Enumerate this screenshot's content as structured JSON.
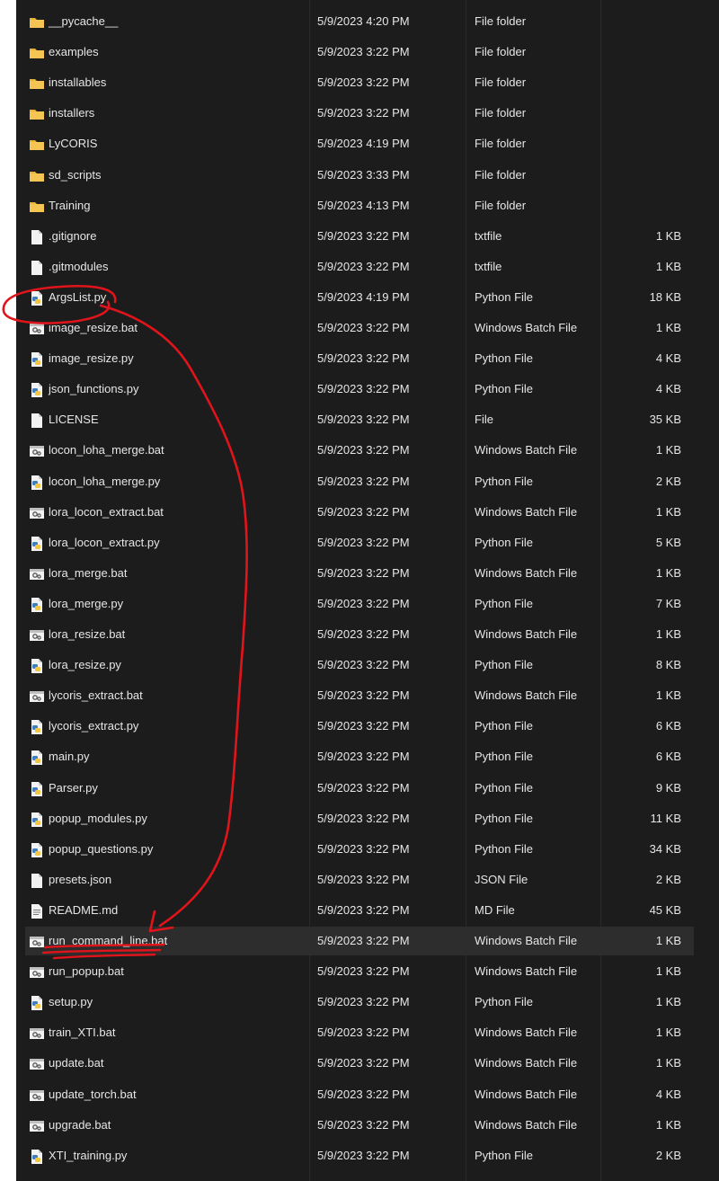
{
  "files": [
    {
      "name": "__pycache__",
      "date": "5/9/2023 4:20 PM",
      "type": "File folder",
      "size": "",
      "icon": "folder-icon"
    },
    {
      "name": "examples",
      "date": "5/9/2023 3:22 PM",
      "type": "File folder",
      "size": "",
      "icon": "folder-icon"
    },
    {
      "name": "installables",
      "date": "5/9/2023 3:22 PM",
      "type": "File folder",
      "size": "",
      "icon": "folder-icon"
    },
    {
      "name": "installers",
      "date": "5/9/2023 3:22 PM",
      "type": "File folder",
      "size": "",
      "icon": "folder-icon"
    },
    {
      "name": "LyCORIS",
      "date": "5/9/2023 4:19 PM",
      "type": "File folder",
      "size": "",
      "icon": "folder-icon"
    },
    {
      "name": "sd_scripts",
      "date": "5/9/2023 3:33 PM",
      "type": "File folder",
      "size": "",
      "icon": "folder-icon"
    },
    {
      "name": "Training",
      "date": "5/9/2023 4:13 PM",
      "type": "File folder",
      "size": "",
      "icon": "folder-icon"
    },
    {
      "name": ".gitignore",
      "date": "5/9/2023 3:22 PM",
      "type": "txtfile",
      "size": "1 KB",
      "icon": "blank-file-icon"
    },
    {
      "name": ".gitmodules",
      "date": "5/9/2023 3:22 PM",
      "type": "txtfile",
      "size": "1 KB",
      "icon": "blank-file-icon"
    },
    {
      "name": "ArgsList.py",
      "date": "5/9/2023 4:19 PM",
      "type": "Python File",
      "size": "18 KB",
      "icon": "python-file-icon"
    },
    {
      "name": "image_resize.bat",
      "date": "5/9/2023 3:22 PM",
      "type": "Windows Batch File",
      "size": "1 KB",
      "icon": "batch-file-icon"
    },
    {
      "name": "image_resize.py",
      "date": "5/9/2023 3:22 PM",
      "type": "Python File",
      "size": "4 KB",
      "icon": "python-file-icon"
    },
    {
      "name": "json_functions.py",
      "date": "5/9/2023 3:22 PM",
      "type": "Python File",
      "size": "4 KB",
      "icon": "python-file-icon"
    },
    {
      "name": "LICENSE",
      "date": "5/9/2023 3:22 PM",
      "type": "File",
      "size": "35 KB",
      "icon": "blank-file-icon"
    },
    {
      "name": "locon_loha_merge.bat",
      "date": "5/9/2023 3:22 PM",
      "type": "Windows Batch File",
      "size": "1 KB",
      "icon": "batch-file-icon"
    },
    {
      "name": "locon_loha_merge.py",
      "date": "5/9/2023 3:22 PM",
      "type": "Python File",
      "size": "2 KB",
      "icon": "python-file-icon"
    },
    {
      "name": "lora_locon_extract.bat",
      "date": "5/9/2023 3:22 PM",
      "type": "Windows Batch File",
      "size": "1 KB",
      "icon": "batch-file-icon"
    },
    {
      "name": "lora_locon_extract.py",
      "date": "5/9/2023 3:22 PM",
      "type": "Python File",
      "size": "5 KB",
      "icon": "python-file-icon"
    },
    {
      "name": "lora_merge.bat",
      "date": "5/9/2023 3:22 PM",
      "type": "Windows Batch File",
      "size": "1 KB",
      "icon": "batch-file-icon"
    },
    {
      "name": "lora_merge.py",
      "date": "5/9/2023 3:22 PM",
      "type": "Python File",
      "size": "7 KB",
      "icon": "python-file-icon"
    },
    {
      "name": "lora_resize.bat",
      "date": "5/9/2023 3:22 PM",
      "type": "Windows Batch File",
      "size": "1 KB",
      "icon": "batch-file-icon"
    },
    {
      "name": "lora_resize.py",
      "date": "5/9/2023 3:22 PM",
      "type": "Python File",
      "size": "8 KB",
      "icon": "python-file-icon"
    },
    {
      "name": "lycoris_extract.bat",
      "date": "5/9/2023 3:22 PM",
      "type": "Windows Batch File",
      "size": "1 KB",
      "icon": "batch-file-icon"
    },
    {
      "name": "lycoris_extract.py",
      "date": "5/9/2023 3:22 PM",
      "type": "Python File",
      "size": "6 KB",
      "icon": "python-file-icon"
    },
    {
      "name": "main.py",
      "date": "5/9/2023 3:22 PM",
      "type": "Python File",
      "size": "6 KB",
      "icon": "python-file-icon"
    },
    {
      "name": "Parser.py",
      "date": "5/9/2023 3:22 PM",
      "type": "Python File",
      "size": "9 KB",
      "icon": "python-file-icon"
    },
    {
      "name": "popup_modules.py",
      "date": "5/9/2023 3:22 PM",
      "type": "Python File",
      "size": "11 KB",
      "icon": "python-file-icon"
    },
    {
      "name": "popup_questions.py",
      "date": "5/9/2023 3:22 PM",
      "type": "Python File",
      "size": "34 KB",
      "icon": "python-file-icon"
    },
    {
      "name": "presets.json",
      "date": "5/9/2023 3:22 PM",
      "type": "JSON File",
      "size": "2 KB",
      "icon": "blank-file-icon"
    },
    {
      "name": "README.md",
      "date": "5/9/2023 3:22 PM",
      "type": "MD File",
      "size": "45 KB",
      "icon": "text-file-icon"
    },
    {
      "name": "run_command_line.bat",
      "date": "5/9/2023 3:22 PM",
      "type": "Windows Batch File",
      "size": "1 KB",
      "icon": "batch-file-icon",
      "selected": true
    },
    {
      "name": "run_popup.bat",
      "date": "5/9/2023 3:22 PM",
      "type": "Windows Batch File",
      "size": "1 KB",
      "icon": "batch-file-icon"
    },
    {
      "name": "setup.py",
      "date": "5/9/2023 3:22 PM",
      "type": "Python File",
      "size": "1 KB",
      "icon": "python-file-icon"
    },
    {
      "name": "train_XTI.bat",
      "date": "5/9/2023 3:22 PM",
      "type": "Windows Batch File",
      "size": "1 KB",
      "icon": "batch-file-icon"
    },
    {
      "name": "update.bat",
      "date": "5/9/2023 3:22 PM",
      "type": "Windows Batch File",
      "size": "1 KB",
      "icon": "batch-file-icon"
    },
    {
      "name": "update_torch.bat",
      "date": "5/9/2023 3:22 PM",
      "type": "Windows Batch File",
      "size": "4 KB",
      "icon": "batch-file-icon"
    },
    {
      "name": "upgrade.bat",
      "date": "5/9/2023 3:22 PM",
      "type": "Windows Batch File",
      "size": "1 KB",
      "icon": "batch-file-icon"
    },
    {
      "name": "XTI_training.py",
      "date": "5/9/2023 3:22 PM",
      "type": "Python File",
      "size": "2 KB",
      "icon": "python-file-icon"
    }
  ],
  "colors": {
    "background": "#1c1c1c",
    "row_selected": "#2d2d2d",
    "text": "#e6e6e6",
    "folder": "#e8b33b",
    "python_blue": "#3f7cc0",
    "python_yellow": "#f2c744",
    "annotation": "#e0141b"
  }
}
